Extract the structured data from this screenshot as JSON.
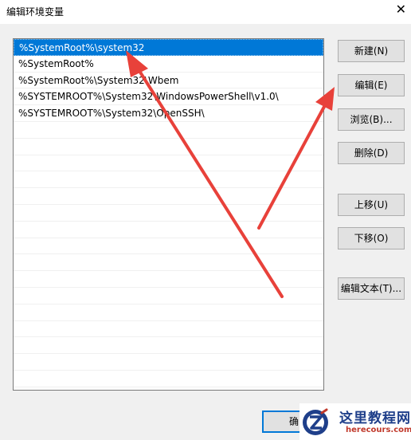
{
  "window": {
    "title": "编辑环境变量",
    "close_glyph": "✕"
  },
  "paths": [
    "%SystemRoot%\\system32",
    "%SystemRoot%",
    "%SystemRoot%\\System32\\Wbem",
    "%SYSTEMROOT%\\System32\\WindowsPowerShell\\v1.0\\",
    "%SYSTEMROOT%\\System32\\OpenSSH\\",
    "",
    "",
    "",
    "",
    "",
    "",
    "",
    "",
    "",
    "",
    "",
    "",
    "",
    "",
    "",
    ""
  ],
  "buttons": {
    "new": "新建(N)",
    "edit": "编辑(E)",
    "browse": "浏览(B)...",
    "delete": "删除(D)",
    "move_up": "上移(U)",
    "move_down": "下移(O)",
    "edit_text": "编辑文本(T)...",
    "ok": "确"
  },
  "watermark": {
    "title": "这里教程网",
    "url": "herecours.com"
  },
  "colors": {
    "selection": "#0078d7",
    "annotation_arrow": "#e8413a"
  }
}
